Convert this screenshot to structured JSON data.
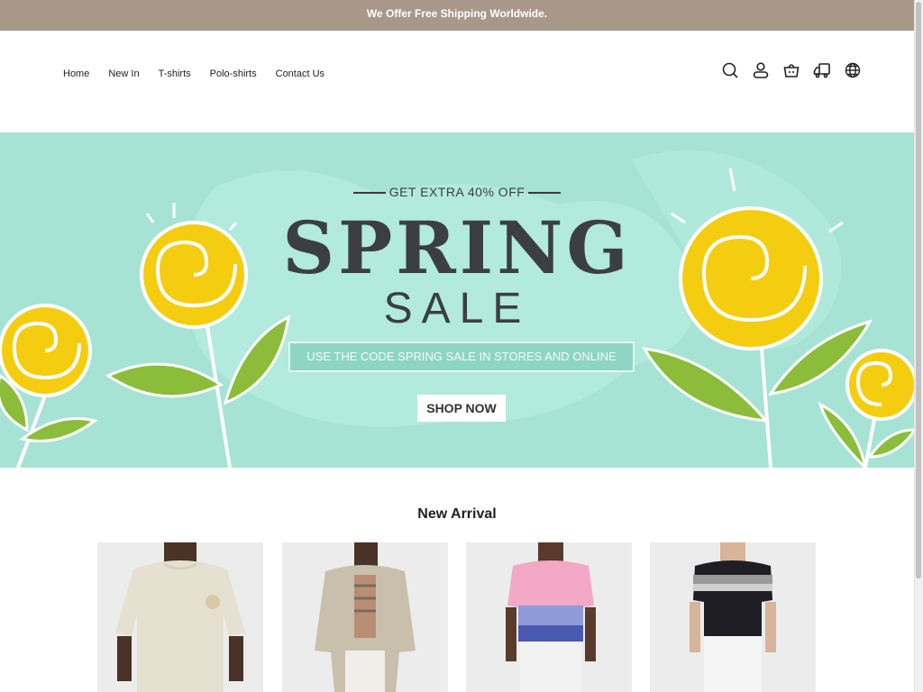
{
  "announcement": "We Offer Free Shipping Worldwide.",
  "nav": [
    "Home",
    "New In",
    "T-shirts",
    "Polo-shirts",
    "Contact Us"
  ],
  "header_icons": [
    "search-icon",
    "account-icon",
    "cart-icon",
    "shipping-icon",
    "globe-icon"
  ],
  "hero": {
    "kicker": "GET EXTRA 40% OFF",
    "title": "SPRING",
    "subtitle": "SALE",
    "code_text": "USE THE CODE SPRING SALE IN STORES AND ONLINE",
    "button": "SHOP NOW"
  },
  "new_arrival": {
    "title": "New Arrival"
  },
  "colors": {
    "announce": "#a8988a",
    "hero_bg": "#a6e3d5",
    "flower": "#f5cd10"
  }
}
